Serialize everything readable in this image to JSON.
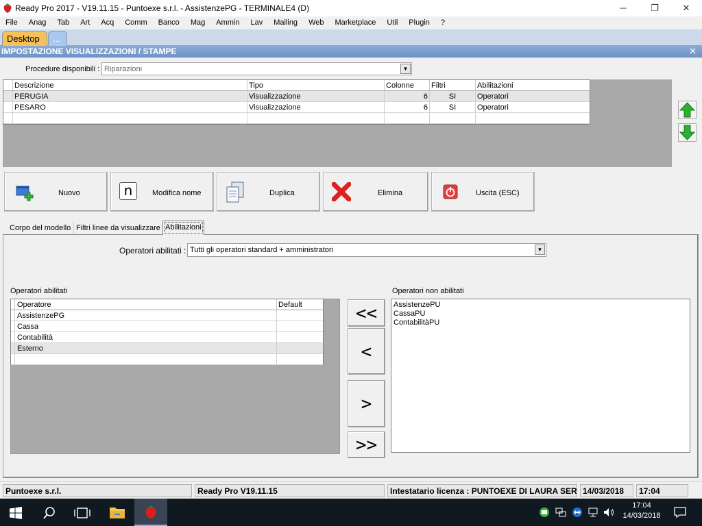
{
  "window": {
    "title": "Ready Pro 2017 - V19.11.15 - Puntoexe s.r.l. - AssistenzePG - TERMINALE4 (D)",
    "minimize": "─",
    "maximize": "❐",
    "close": "✕"
  },
  "menu": [
    "File",
    "Anag",
    "Tab",
    "Art",
    "Acq",
    "Comm",
    "Banco",
    "Mag",
    "Ammin",
    "Lav",
    "Mailing",
    "Web",
    "Marketplace",
    "Util",
    "Plugin",
    "?"
  ],
  "desktop_tabs": {
    "desktop": "Desktop",
    "more": "..."
  },
  "header": {
    "title": "IMPOSTAZIONE VISUALIZZAZIONI / STAMPE",
    "close": "✕"
  },
  "procedure": {
    "label": "Procedure disponibili :",
    "value": "Riparazioni"
  },
  "models_grid": {
    "columns": [
      "Descrizione",
      "Tipo",
      "Colonne",
      "Filtri",
      "Abilitazioni"
    ],
    "rows": [
      {
        "descrizione": "PERUGIA",
        "tipo": "Visualizzazione",
        "colonne": "6",
        "filtri": "SI",
        "abilitazioni": "Operatori"
      },
      {
        "descrizione": "PESARO",
        "tipo": "Visualizzazione",
        "colonne": "6",
        "filtri": "SI",
        "abilitazioni": "Operatori"
      }
    ]
  },
  "actions": {
    "nuovo": "Nuovo",
    "modifica_icon_letter": "n",
    "modifica": "Modifica nome",
    "duplica": "Duplica",
    "elimina": "Elimina",
    "uscita": "Uscita (ESC)"
  },
  "panel_tabs": [
    "Corpo del modello",
    "Filtri linee da visualizzare",
    "Abilitazioni"
  ],
  "operatori_abilitati_combo": {
    "label": "Operatori abilitati :",
    "value": "Tutti gli operatori standard + amministratori"
  },
  "enabled_ops": {
    "title": "Operatori abilitati",
    "columns": [
      "Operatore",
      "Default"
    ],
    "rows": [
      "AssistenzePG",
      "Cassa",
      "Contabilità",
      "Esterno"
    ]
  },
  "disabled_ops": {
    "title": "Operatori non abilitati",
    "items": [
      "AssistenzePU",
      "CassaPU",
      "ContabilitàPU"
    ]
  },
  "transfer_buttons": {
    "all_left": "<<",
    "left": "<",
    "right": ">",
    "all_right": ">>"
  },
  "status": {
    "company": "Puntoexe s.r.l.",
    "version": "Ready Pro V19.11.15",
    "license": "Intestatario licenza : PUNTOEXE DI LAURA SERAFINI",
    "date": "14/03/2018",
    "time": "17:04"
  },
  "taskbar": {
    "time": "17:04",
    "date": "14/03/2018"
  },
  "colors": {
    "header_blue": "#6f93c8",
    "tab_orange": "#f7c15a",
    "delete_red": "#e02020",
    "arrow_green": "#2fae2f"
  }
}
